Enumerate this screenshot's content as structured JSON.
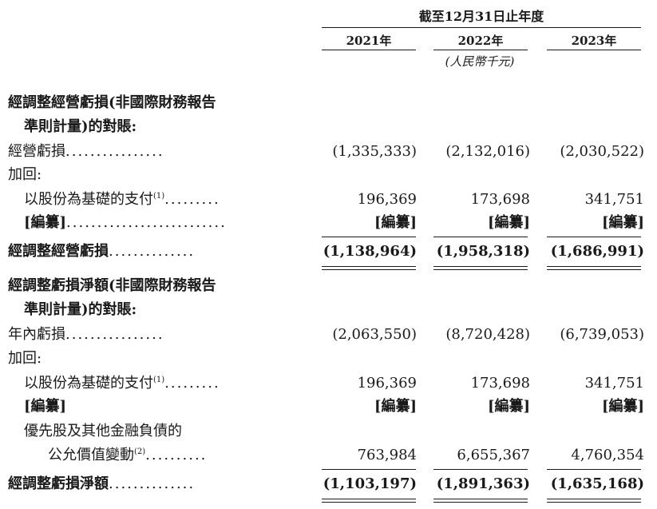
{
  "header": {
    "period": "截至12月31日止年度",
    "years": [
      "2021年",
      "2022年",
      "2023年"
    ],
    "unit": "(人民幣千元)"
  },
  "section1": {
    "title_line1": "經調整經營虧損(非國際財務報告",
    "title_line2": "準則計量)的對賬:",
    "operating_loss": {
      "label": "經營虧損",
      "values": [
        "(1,335,333)",
        "(2,132,016)",
        "(2,030,522)"
      ]
    },
    "add_back": "加回:",
    "share_based": {
      "label": "以股份為基礎的支付",
      "note": "(1)",
      "values": [
        "196,369",
        "173,698",
        "341,751"
      ]
    },
    "redacted": {
      "label": "[編纂]",
      "values": [
        "[編纂]",
        "[編纂]",
        "[編纂]"
      ]
    },
    "adjusted": {
      "label": "經調整經營虧損",
      "values": [
        "(1,138,964)",
        "(1,958,318)",
        "(1,686,991)"
      ]
    }
  },
  "section2": {
    "title_line1": "經調整虧損淨額(非國際財務報告",
    "title_line2": "準則計量)的對賬:",
    "annual_loss": {
      "label": "年內虧損",
      "values": [
        "(2,063,550)",
        "(8,720,428)",
        "(6,739,053)"
      ]
    },
    "add_back": "加回:",
    "share_based": {
      "label": "以股份為基礎的支付",
      "note": "(1)",
      "values": [
        "196,369",
        "173,698",
        "341,751"
      ]
    },
    "redacted": {
      "label": "[編纂]",
      "values": [
        "[編纂]",
        "[編纂]",
        "[編纂]"
      ]
    },
    "fair_value_line1": "優先股及其他金融負債的",
    "fair_value": {
      "label": "公允價值變動",
      "note": "(2)",
      "values": [
        "763,984",
        "6,655,367",
        "4,760,354"
      ]
    },
    "adjusted": {
      "label": "經調整虧損淨額",
      "values": [
        "(1,103,197)",
        "(1,891,363)",
        "(1,635,168)"
      ]
    }
  }
}
